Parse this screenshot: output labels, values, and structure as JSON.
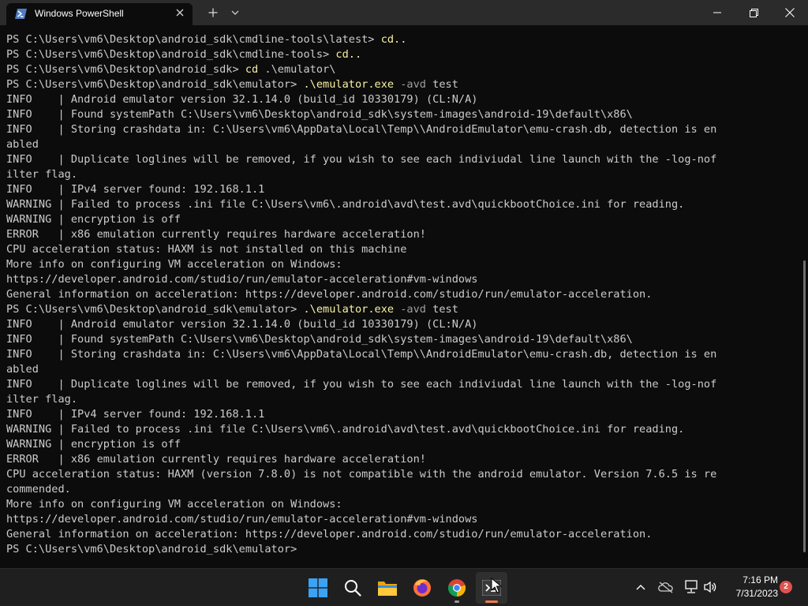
{
  "window": {
    "tab_title": "Windows PowerShell",
    "icons": {
      "tab": "powershell-icon",
      "tab_close": "close-icon",
      "new_tab": "plus-icon",
      "dropdown": "chevron-down-icon",
      "minimize": "minimize-icon",
      "maximize": "restore-icon",
      "close": "close-icon"
    }
  },
  "terminal": {
    "colors": {
      "background": "#0c0c0c",
      "text": "#cccccc",
      "command": "#f9f1a5",
      "parameter": "#9e9e9e"
    },
    "lines": [
      {
        "segments": [
          {
            "t": "PS C:\\Users\\vm6\\Desktop\\android_sdk\\cmdline-tools\\latest> ",
            "c": "text"
          },
          {
            "t": "cd..",
            "c": "cmd"
          }
        ]
      },
      {
        "segments": [
          {
            "t": "PS C:\\Users\\vm6\\Desktop\\android_sdk\\cmdline-tools> ",
            "c": "text"
          },
          {
            "t": "cd..",
            "c": "cmd"
          }
        ]
      },
      {
        "segments": [
          {
            "t": "PS C:\\Users\\vm6\\Desktop\\android_sdk> ",
            "c": "text"
          },
          {
            "t": "cd",
            "c": "cmd"
          },
          {
            "t": " .\\emulator\\",
            "c": "arg"
          }
        ]
      },
      {
        "segments": [
          {
            "t": "PS C:\\Users\\vm6\\Desktop\\android_sdk\\emulator> ",
            "c": "text"
          },
          {
            "t": ".\\emulator.exe",
            "c": "cmd"
          },
          {
            "t": " -avd",
            "c": "param"
          },
          {
            "t": " test",
            "c": "arg"
          }
        ]
      },
      {
        "segments": [
          {
            "t": "INFO    | Android emulator version 32.1.14.0 (build_id 10330179) (CL:N/A)",
            "c": "text"
          }
        ]
      },
      {
        "segments": [
          {
            "t": "INFO    | Found systemPath C:\\Users\\vm6\\Desktop\\android_sdk\\system-images\\android-19\\default\\x86\\",
            "c": "text"
          }
        ]
      },
      {
        "segments": [
          {
            "t": "INFO    | Storing crashdata in: C:\\Users\\vm6\\AppData\\Local\\Temp\\\\AndroidEmulator\\emu-crash.db, detection is en",
            "c": "text"
          }
        ]
      },
      {
        "segments": [
          {
            "t": "abled",
            "c": "text"
          }
        ]
      },
      {
        "segments": [
          {
            "t": "INFO    | Duplicate loglines will be removed, if you wish to see each indiviudal line launch with the -log-nof",
            "c": "text"
          }
        ]
      },
      {
        "segments": [
          {
            "t": "ilter flag.",
            "c": "text"
          }
        ]
      },
      {
        "segments": [
          {
            "t": "INFO    | IPv4 server found: 192.168.1.1",
            "c": "text"
          }
        ]
      },
      {
        "segments": [
          {
            "t": "WARNING | Failed to process .ini file C:\\Users\\vm6\\.android\\avd\\test.avd\\quickbootChoice.ini for reading.",
            "c": "text"
          }
        ]
      },
      {
        "segments": [
          {
            "t": "WARNING | encryption is off",
            "c": "text"
          }
        ]
      },
      {
        "segments": [
          {
            "t": "ERROR   | x86 emulation currently requires hardware acceleration!",
            "c": "text"
          }
        ]
      },
      {
        "segments": [
          {
            "t": "CPU acceleration status: HAXM is not installed on this machine",
            "c": "text"
          }
        ]
      },
      {
        "segments": [
          {
            "t": "More info on configuring VM acceleration on Windows:",
            "c": "text"
          }
        ]
      },
      {
        "segments": [
          {
            "t": "https://developer.android.com/studio/run/emulator-acceleration#vm-windows",
            "c": "text"
          }
        ]
      },
      {
        "segments": [
          {
            "t": "General information on acceleration: https://developer.android.com/studio/run/emulator-acceleration.",
            "c": "text"
          }
        ]
      },
      {
        "segments": [
          {
            "t": "PS C:\\Users\\vm6\\Desktop\\android_sdk\\emulator> ",
            "c": "text"
          },
          {
            "t": ".\\emulator.exe",
            "c": "cmd"
          },
          {
            "t": " -avd",
            "c": "param"
          },
          {
            "t": " test",
            "c": "arg"
          }
        ]
      },
      {
        "segments": [
          {
            "t": "INFO    | Android emulator version 32.1.14.0 (build_id 10330179) (CL:N/A)",
            "c": "text"
          }
        ]
      },
      {
        "segments": [
          {
            "t": "INFO    | Found systemPath C:\\Users\\vm6\\Desktop\\android_sdk\\system-images\\android-19\\default\\x86\\",
            "c": "text"
          }
        ]
      },
      {
        "segments": [
          {
            "t": "INFO    | Storing crashdata in: C:\\Users\\vm6\\AppData\\Local\\Temp\\\\AndroidEmulator\\emu-crash.db, detection is en",
            "c": "text"
          }
        ]
      },
      {
        "segments": [
          {
            "t": "abled",
            "c": "text"
          }
        ]
      },
      {
        "segments": [
          {
            "t": "INFO    | Duplicate loglines will be removed, if you wish to see each indiviudal line launch with the -log-nof",
            "c": "text"
          }
        ]
      },
      {
        "segments": [
          {
            "t": "ilter flag.",
            "c": "text"
          }
        ]
      },
      {
        "segments": [
          {
            "t": "INFO    | IPv4 server found: 192.168.1.1",
            "c": "text"
          }
        ]
      },
      {
        "segments": [
          {
            "t": "WARNING | Failed to process .ini file C:\\Users\\vm6\\.android\\avd\\test.avd\\quickbootChoice.ini for reading.",
            "c": "text"
          }
        ]
      },
      {
        "segments": [
          {
            "t": "WARNING | encryption is off",
            "c": "text"
          }
        ]
      },
      {
        "segments": [
          {
            "t": "ERROR   | x86 emulation currently requires hardware acceleration!",
            "c": "text"
          }
        ]
      },
      {
        "segments": [
          {
            "t": "CPU acceleration status: HAXM (version 7.8.0) is not compatible with the android emulator. Version 7.6.5 is re",
            "c": "text"
          }
        ]
      },
      {
        "segments": [
          {
            "t": "commended.",
            "c": "text"
          }
        ]
      },
      {
        "segments": [
          {
            "t": "More info on configuring VM acceleration on Windows:",
            "c": "text"
          }
        ]
      },
      {
        "segments": [
          {
            "t": "https://developer.android.com/studio/run/emulator-acceleration#vm-windows",
            "c": "text"
          }
        ]
      },
      {
        "segments": [
          {
            "t": "General information on acceleration: https://developer.android.com/studio/run/emulator-acceleration.",
            "c": "text"
          }
        ]
      },
      {
        "segments": [
          {
            "t": "PS C:\\Users\\vm6\\Desktop\\android_sdk\\emulator> ",
            "c": "text"
          }
        ]
      }
    ]
  },
  "taskbar": {
    "apps": [
      "windows-start-icon",
      "search-icon",
      "file-explorer-icon",
      "firefox-icon",
      "chrome-icon",
      "terminal-icon"
    ],
    "tray_icons": [
      "chevron-up-icon",
      "onedrive-icon",
      "network-icon",
      "volume-icon"
    ],
    "time": "7:16 PM",
    "date": "7/31/2023",
    "notification_count": "2"
  }
}
